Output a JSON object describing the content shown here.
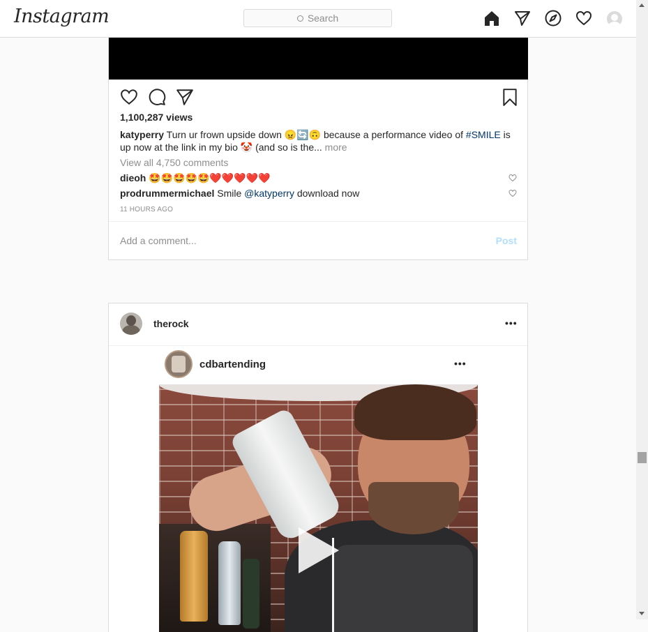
{
  "app": {
    "logo": "Instagram"
  },
  "search": {
    "placeholder": "Search"
  },
  "nav": {
    "icons": [
      "home-icon",
      "direct-icon",
      "explore-icon",
      "activity-heart-icon",
      "profile-avatar"
    ]
  },
  "post1": {
    "views": "1,100,287 views",
    "caption": {
      "username": "katyperry",
      "text_part1": " Turn ur frown upside down 😠🔄🙃 because a performance video of ",
      "hashtag": "#SMILE",
      "text_part2": " is up now at the link in my bio 🤡 (and so is the...",
      "more": " more"
    },
    "view_all_comments": "View all 4,750 comments",
    "comments": [
      {
        "username": "dieoh",
        "text": " 🤩🤩🤩🤩🤩❤️❤️❤️❤️❤️"
      },
      {
        "username": "prodrummermichael",
        "text_before": " Smile ",
        "mention": "@katyperry",
        "text_after": " download now"
      }
    ],
    "time_ago": "11 HOURS AGO",
    "add_comment_placeholder": "Add a comment...",
    "post_button": "Post"
  },
  "post2": {
    "username": "therock",
    "more_options": "•••",
    "inner_username": "cdbartending",
    "inner_more_options": "•••"
  },
  "colors": {
    "accent": "#262626",
    "link": "#00376b",
    "post_disabled": "#b2dffc",
    "muted": "#8e8e8e"
  }
}
